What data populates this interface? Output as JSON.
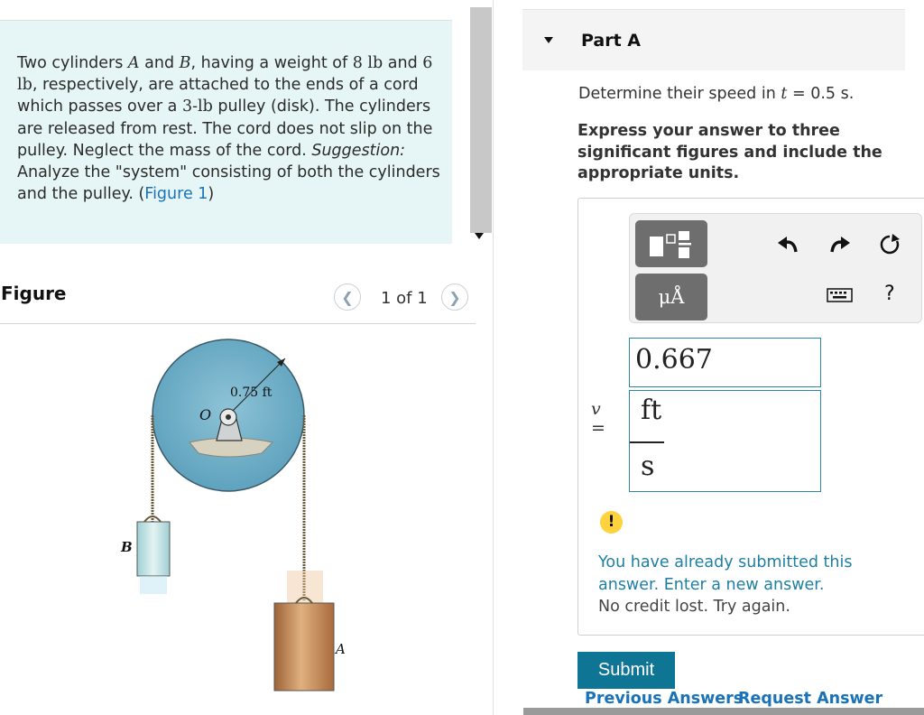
{
  "problem": {
    "text_parts": [
      "Two cylinders ",
      "A",
      " and ",
      "B",
      ", having a weight of ",
      "8 lb",
      " and ",
      "6 lb",
      ", respectively, are attached to the ends of a cord which passes over a ",
      "3-lb",
      " pulley (disk). The cylinders are released from rest. The cord does not slip on the pulley. Neglect the mass of the cord. ",
      "Suggestion:",
      " Analyze the \"system\" consisting of both the cylinders and the pulley. (",
      "Figure 1",
      ")"
    ]
  },
  "figure": {
    "heading": "Figure",
    "pager_text": "1 of 1",
    "prev_icon": "chevron-left-icon",
    "next_icon": "chevron-right-icon",
    "labels": {
      "radius": "0.75 ft",
      "center": "O",
      "cylinder_b": "B",
      "cylinder_a": "A"
    },
    "colors": {
      "pulley": "#6aaec8",
      "cylinder_b": "#bfe0e2",
      "cylinder_a": "#c48a58"
    }
  },
  "part": {
    "title": "Part A",
    "question_prefix": "Determine their speed in ",
    "question_var": "t",
    "question_suffix": " = 0.5 s.",
    "instructions": "Express your answer to three significant figures and include the appropriate units."
  },
  "toolbar": {
    "units_label": "μÅ",
    "help_label": "?",
    "icons": [
      "templates-icon",
      "units-icon",
      "undo-icon",
      "redo-icon",
      "reset-icon",
      "keyboard-icon",
      "help-icon"
    ]
  },
  "answer": {
    "variable": "v",
    "equals": "=",
    "value": "0.667",
    "unit_numerator": "ft",
    "unit_denominator": "s"
  },
  "feedback": {
    "icon": "!",
    "message": "You have already submitted this answer. Enter a new answer.",
    "note": "No credit lost. Try again."
  },
  "actions": {
    "submit": "Submit",
    "previous_answers": "Previous Answers",
    "request_answer": "Request Answer"
  },
  "colors": {
    "accent": "#0f7595",
    "link": "#1a73b8",
    "problem_bg": "#e6f5f5",
    "alert": "#ffd23e"
  }
}
